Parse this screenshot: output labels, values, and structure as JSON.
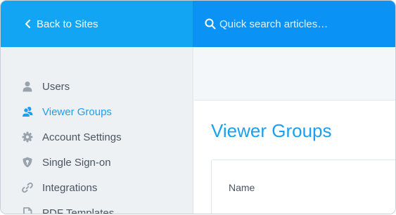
{
  "header": {
    "back_label": "Back to Sites",
    "search_placeholder": "Quick search articles…"
  },
  "sidebar": {
    "items": [
      {
        "label": "Users",
        "icon": "user-icon",
        "active": false
      },
      {
        "label": "Viewer Groups",
        "icon": "viewer-groups-icon",
        "active": true
      },
      {
        "label": "Account Settings",
        "icon": "gear-icon",
        "active": false
      },
      {
        "label": "Single Sign-on",
        "icon": "shield-icon",
        "active": false
      },
      {
        "label": "Integrations",
        "icon": "link-icon",
        "active": false
      },
      {
        "label": "PDF Templates",
        "icon": "document-icon",
        "active": false
      }
    ]
  },
  "main": {
    "title": "Viewer Groups",
    "table": {
      "columns": [
        "Name"
      ]
    }
  },
  "colors": {
    "header_left": "#12a5f4",
    "header_right": "#0b92f5",
    "accent": "#1aa0f0",
    "sidebar_bg": "#eef1f4",
    "text": "#4a5561"
  }
}
